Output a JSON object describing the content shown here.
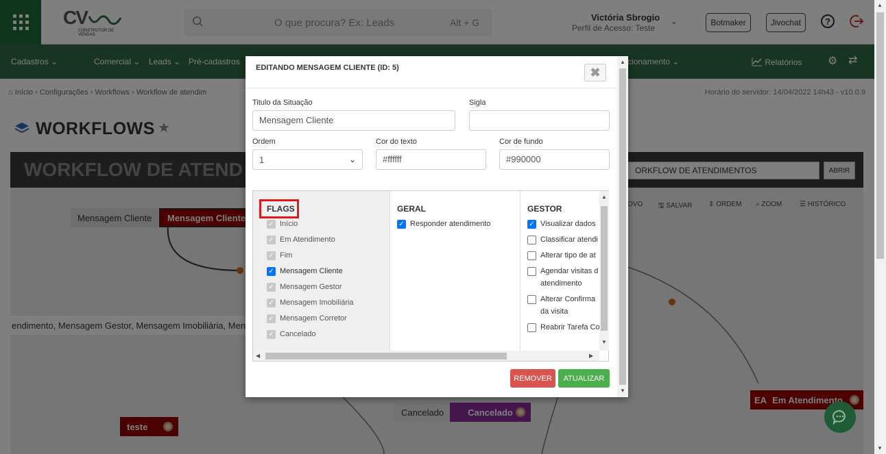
{
  "header": {
    "logo_text": "CV",
    "logo_sub": "CONSTRUTOR DE VENDAS",
    "search_placeholder": "O que procura? Ex: Leads",
    "search_shortcut": "Alt + G",
    "user_name": "Victória Sbrogio",
    "user_role": "Perfil de Acesso: Teste",
    "botmaker_label": "Botmaker",
    "jivochat_label": "Jivochat"
  },
  "nav": {
    "items": [
      "Cadastros",
      "Comercial",
      "Leads",
      "Pré-cadastros"
    ],
    "trailing": "cionamento",
    "reports": "Relatórios"
  },
  "breadcrumb": [
    "Início",
    "Configurações",
    "Workflows",
    "Workflow de atendim"
  ],
  "server_time": "Horário do servidor: 14/04/2022 14h43 - v10.0.9",
  "page": {
    "title": "WORKFLOWS",
    "workflow_title": "WORKFLOW DE ATEND",
    "workflow_select": "ORKFLOW DE ATENDIMENTOS",
    "open_label": "ABRIR",
    "tools": [
      "OVO",
      "SALVAR",
      "ORDEM",
      "ZOOM",
      "HISTÓRICO"
    ]
  },
  "nodes": {
    "mensagem_cliente_a": "Mensagem Cliente",
    "mensagem_cliente_b": "Mensagem Cliente",
    "flags_line": "endimento, Mensagem Gestor, Mensagem Imobiliária, Mensa",
    "teste": "teste",
    "cancelado_a": "Cancelado",
    "cancelado_b": "Cancelado",
    "ea_label": "EA",
    "em_atendimento": "Em Atendimento"
  },
  "modal": {
    "title": "EDITANDO MENSAGEM CLIENTE (ID: 5)",
    "close": "✖",
    "titulo_label": "Titulo da Situação",
    "titulo_value": "Mensagem Cliente",
    "sigla_label": "Sigla",
    "sigla_value": "",
    "ordem_label": "Ordem",
    "ordem_value": "1",
    "cor_texto_label": "Cor do texto",
    "cor_texto_value": "#ffffff",
    "cor_fundo_label": "Cor de fundo",
    "cor_fundo_value": "#990000",
    "flags_head": "FLAGS",
    "geral_head": "GERAL",
    "gestor_head": "GESTOR",
    "flags": [
      "Início",
      "Em Atendimento",
      "Fim",
      "Mensagem Cliente",
      "Mensagem Gestor",
      "Mensagem Imobiliária",
      "Mensagem Corretor",
      "Cancelado"
    ],
    "geral": [
      "Responder atendimento"
    ],
    "gestor": [
      "Visualizar dados",
      "Classificar atendi",
      "Alterar tipo de at",
      "Agendar visitas d",
      "atendimento",
      "Alterar Confirma",
      "da visita",
      "Reabrir Tarefa Co"
    ],
    "remove_label": "REMOVER",
    "update_label": "ATUALIZAR"
  },
  "colors": {
    "brand_green": "#2f6a45",
    "apps_green": "#1e6b3a",
    "remove_red": "#d9534f",
    "update_green": "#4cae4c",
    "highlight_red": "#e01a1a",
    "node_red": "#990000",
    "node_purple": "#8b2c9c"
  },
  "icons": [
    "apps-grid-icon",
    "search-icon",
    "chevron-down-icon",
    "help-icon",
    "logout-icon",
    "chart-icon",
    "gear-icon",
    "swap-icon",
    "home-icon",
    "layers-icon",
    "star-icon",
    "close-icon",
    "chat-icon"
  ]
}
